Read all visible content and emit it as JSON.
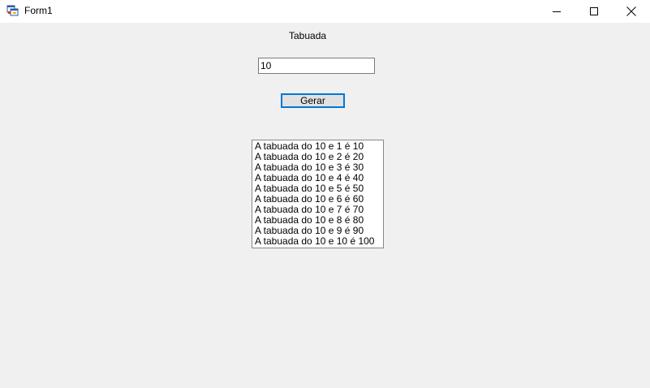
{
  "window": {
    "title": "Form1",
    "icon": "winforms-app-icon",
    "controls": [
      "minimize-icon",
      "maximize-icon",
      "close-icon"
    ]
  },
  "form": {
    "label": "Tabuada",
    "input_value": "10",
    "button_label": "Gerar",
    "results": [
      "A tabuada do 10 e 1 é 10",
      "A tabuada do 10 e 2 é 20",
      "A tabuada do 10 e 3 é 30",
      "A tabuada do 10 e 4 é 40",
      "A tabuada do 10 e 5 é 50",
      "A tabuada do 10 e 6 é 60",
      "A tabuada do 10 e 7 é 70",
      "A tabuada do 10 e 8 é 80",
      "A tabuada do 10 e 9 é 90",
      "A tabuada do 10 e 10 é 100"
    ]
  },
  "colors": {
    "form_background": "#f0f0f0",
    "titlebar_background": "#ffffff",
    "button_focus_border": "#0078d7"
  }
}
